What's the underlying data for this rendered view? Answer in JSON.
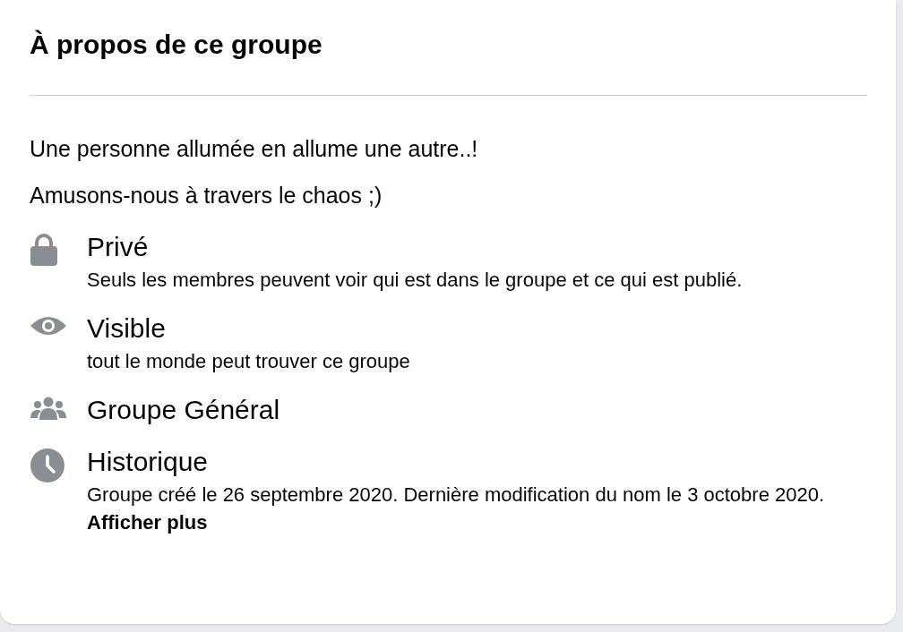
{
  "card": {
    "title": "À propos de ce groupe",
    "description": [
      "Une personne allumée en allume une autre..!",
      "Amusons-nous à travers le chaos ;)"
    ],
    "items": [
      {
        "kind": "lock",
        "title": "Privé",
        "text": "Seuls les membres peuvent voir qui est dans le groupe et ce qui est publié."
      },
      {
        "kind": "eye",
        "title": "Visible",
        "text": "tout le monde peut trouver ce groupe"
      },
      {
        "kind": "people",
        "title": "Groupe Général"
      },
      {
        "kind": "clock",
        "title": "Historique",
        "text": "Groupe créé le 26 septembre 2020. Dernière modification du nom le 3 octobre 2020. **Afficher plus**"
      }
    ]
  }
}
